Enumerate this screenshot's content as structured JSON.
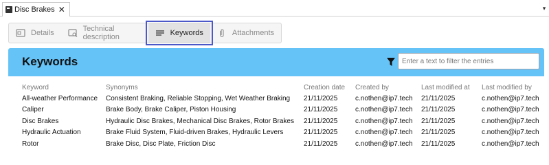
{
  "document_tab": {
    "title": "Disc Brakes",
    "close_glyph": "✕"
  },
  "overflow_glyph": "▾",
  "subtabs": [
    {
      "label": "Details",
      "icon": "details-icon",
      "active": false
    },
    {
      "label": "Technical description",
      "icon": "technical-description-icon",
      "active": false
    },
    {
      "label": "Keywords",
      "icon": "lines-icon",
      "active": true
    },
    {
      "label": "Attachments",
      "icon": "paperclip-icon",
      "active": false
    }
  ],
  "panel": {
    "title": "Keywords",
    "filter_placeholder": "Enter a text to filter the entries",
    "header_color": "#66c3f7"
  },
  "table": {
    "columns": [
      "Keyword",
      "Synonyms",
      "Creation date",
      "Created by",
      "Last modified at",
      "Last modified by"
    ],
    "rows": [
      [
        "All-weather Performance",
        "Consistent Braking, Reliable Stopping, Wet Weather Braking",
        "21/11/2025",
        "c.nothen@ip7.tech",
        "21/11/2025",
        "c.nothen@ip7.tech"
      ],
      [
        "Caliper",
        "Brake Body, Brake Caliper, Piston Housing",
        "21/11/2025",
        "c.nothen@ip7.tech",
        "21/11/2025",
        "c.nothen@ip7.tech"
      ],
      [
        "Disc Brakes",
        "Hydraulic Disc Brakes, Mechanical Disc Brakes, Rotor Brakes",
        "21/11/2025",
        "c.nothen@ip7.tech",
        "21/11/2025",
        "c.nothen@ip7.tech"
      ],
      [
        "Hydraulic Actuation",
        "Brake Fluid System, Fluid-driven Brakes, Hydraulic Levers",
        "21/11/2025",
        "c.nothen@ip7.tech",
        "21/11/2025",
        "c.nothen@ip7.tech"
      ],
      [
        "Rotor",
        "Brake Disc, Disc Plate, Friction Disc",
        "21/11/2025",
        "c.nothen@ip7.tech",
        "21/11/2025",
        "c.nothen@ip7.tech"
      ]
    ]
  }
}
